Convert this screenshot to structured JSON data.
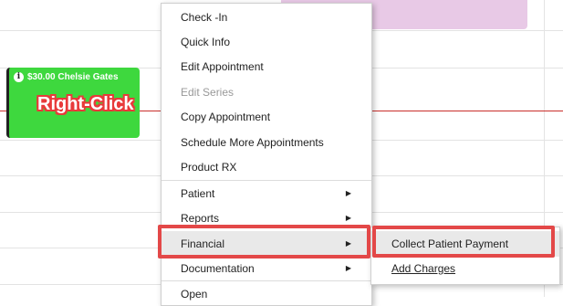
{
  "appointment": {
    "header": "$30.00 Chelsie Gates",
    "annotation": "Right-Click"
  },
  "context_menu": {
    "items": [
      {
        "label": "Check -In",
        "has_submenu": false,
        "disabled": false
      },
      {
        "label": "Quick Info",
        "has_submenu": false,
        "disabled": false
      },
      {
        "label": "Edit Appointment",
        "has_submenu": false,
        "disabled": false
      },
      {
        "label": "Edit Series",
        "has_submenu": false,
        "disabled": true
      },
      {
        "label": "Copy Appointment",
        "has_submenu": false,
        "disabled": false
      },
      {
        "label": "Schedule More Appointments",
        "has_submenu": false,
        "disabled": false
      },
      {
        "label": "Product RX",
        "has_submenu": false,
        "disabled": false
      },
      {
        "label": "Patient",
        "has_submenu": true,
        "disabled": false
      },
      {
        "label": "Reports",
        "has_submenu": true,
        "disabled": false
      },
      {
        "label": "Financial",
        "has_submenu": true,
        "disabled": false
      },
      {
        "label": "Documentation",
        "has_submenu": true,
        "disabled": false
      },
      {
        "label": "Open",
        "has_submenu": false,
        "disabled": false
      }
    ],
    "arrow": "▶"
  },
  "financial_submenu": {
    "items": [
      {
        "label": "Collect Patient Payment"
      },
      {
        "label": "Add Charges"
      }
    ]
  },
  "colors": {
    "appointment_green": "#3ed83e",
    "appointment_purple": "#e8c9e6",
    "highlight_red": "#e34848",
    "time_line": "#c9302c"
  }
}
